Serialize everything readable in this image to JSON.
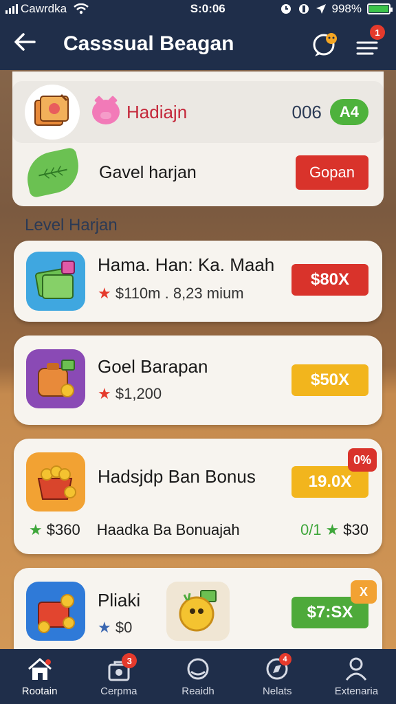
{
  "status_bar": {
    "carrier": "Cawrdka",
    "time": "S:0:06",
    "battery": "998%"
  },
  "header": {
    "title": "Casssual Beagan",
    "notifications_count": "1"
  },
  "top_row": {
    "name": "Hadiajn",
    "number": "006",
    "pill": "A4"
  },
  "second_row": {
    "name": "Gavel harjan",
    "button_label": "Gopan"
  },
  "section_label": "Level Harjan",
  "cards": [
    {
      "name": "Hama. Han: Ka. Maah",
      "star": "★",
      "sub": "$110m . 8,23 mium",
      "price": "$80X",
      "price_color": "#d9332b"
    },
    {
      "name": "Goel Barapan",
      "star": "★",
      "sub": "$1,200",
      "price": "$50X",
      "price_color": "#f2b51d"
    },
    {
      "name": "Hadsjdp Ban Bonus",
      "price": "19.0X",
      "price_color": "#f2b51d",
      "corner_badge": "0%",
      "left_star": "★",
      "left_amount": "$360",
      "middle_text": "Haadka Ba Bonuajah",
      "right_prefix": "0/1",
      "right_star": "★",
      "right_amount": "$30"
    },
    {
      "name": "Pliaki",
      "star": "★",
      "sub": "$0",
      "price": "$7:SX",
      "price_color": "#4eaa3a",
      "corner_badge": "X"
    }
  ],
  "nav": [
    {
      "label": "Rootain",
      "icon": "home-icon",
      "active": true
    },
    {
      "label": "Cerpma",
      "icon": "shop-icon",
      "badge": "3"
    },
    {
      "label": "Reaidh",
      "icon": "chat-icon"
    },
    {
      "label": "Nelats",
      "icon": "compass-icon",
      "badge": "4"
    },
    {
      "label": "Extenaria",
      "icon": "profile-icon"
    }
  ]
}
